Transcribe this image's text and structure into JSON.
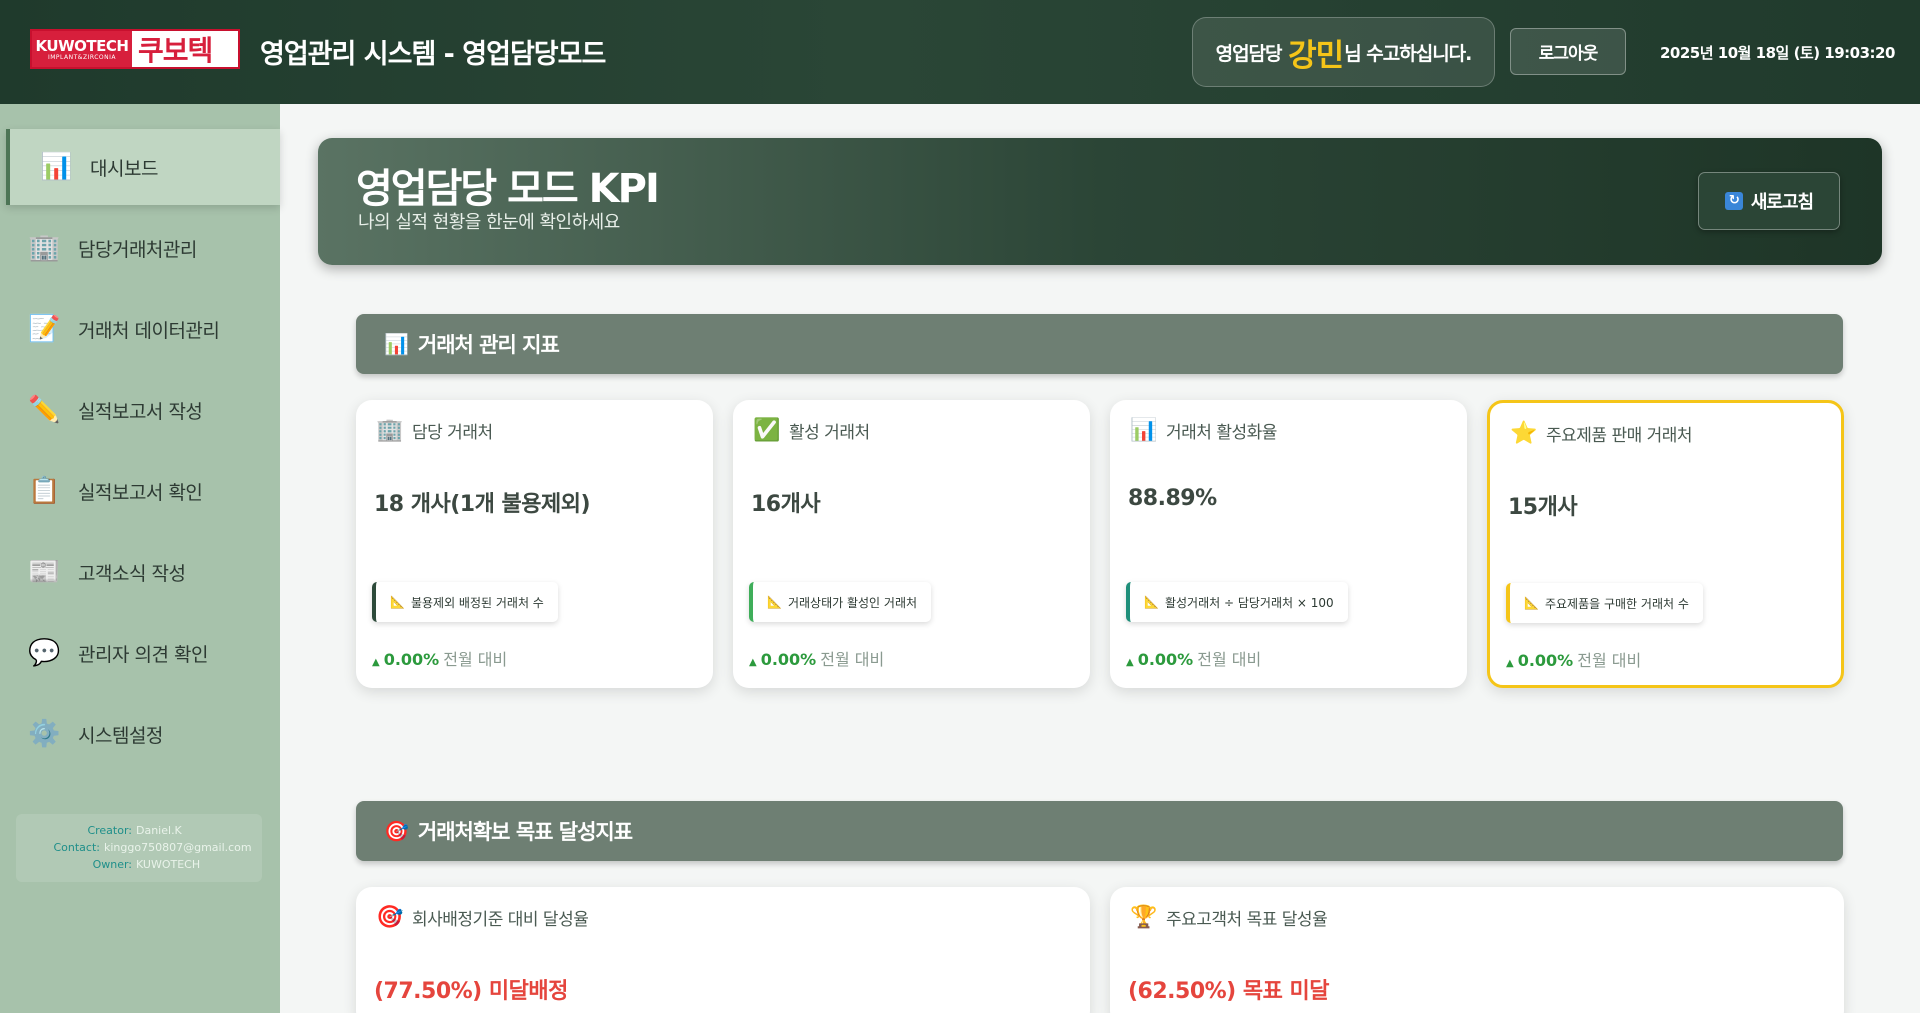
{
  "header": {
    "logo_en": "KUWOTECH",
    "logo_sub": "IMPLANT&ZIRCONIA",
    "logo_kr": "쿠보텍",
    "title": "영업관리 시스템 - 영업담당모드",
    "welcome_prefix": "영업담당",
    "user_name": "강민",
    "welcome_suffix": "님 수고하십니다.",
    "logout_label": "로그아웃",
    "datetime": "2025년 10월 18일 (토) 19:03:20"
  },
  "sidebar": {
    "items": [
      {
        "label": "대시보드",
        "icon": "chart-icon"
      },
      {
        "label": "담당거래처관리",
        "icon": "building-icon"
      },
      {
        "label": "거래처 데이터관리",
        "icon": "memo-icon"
      },
      {
        "label": "실적보고서 작성",
        "icon": "pencil-icon"
      },
      {
        "label": "실적보고서 확인",
        "icon": "clipboard-icon"
      },
      {
        "label": "고객소식 작성",
        "icon": "newspaper-icon"
      },
      {
        "label": "관리자 의견 확인",
        "icon": "speech-bubble-icon"
      },
      {
        "label": "시스템설정",
        "icon": "gear-icon"
      }
    ],
    "credits": {
      "creator_label": "Creator:",
      "creator": "Daniel.K",
      "contact_label": "Contact:",
      "contact": "kinggo750807@gmail.com",
      "owner_label": "Owner:",
      "owner": "KUWOTECH"
    }
  },
  "banner": {
    "title": "영업담당 모드 KPI",
    "subtitle": "나의 실적 현황을 한눈에 확인하세요",
    "refresh_label": "새로고침"
  },
  "section1": {
    "title": "거래처 관리 지표",
    "cards": [
      {
        "title": "담당 거래처",
        "value": "18 개사(1개 불용제외)",
        "note": "불용제외 배정된 거래처 수",
        "change": "0.00%",
        "change_label": "전월 대비",
        "accent": "#2d4a3a"
      },
      {
        "title": "활성 거래처",
        "value": "16개사",
        "note": "거래상태가 활성인 거래처",
        "change": "0.00%",
        "change_label": "전월 대비",
        "accent": "#3fae5a"
      },
      {
        "title": "거래처 활성화율",
        "value": "88.89%",
        "note": "활성거래처 ÷ 담당거래처 × 100",
        "change": "0.00%",
        "change_label": "전월 대비",
        "accent": "#1f8f7a"
      },
      {
        "title": "주요제품 판매 거래처",
        "value": "15개사",
        "note": "주요제품을 구매한 거래처 수",
        "change": "0.00%",
        "change_label": "전월 대비",
        "accent": "#f5c518"
      }
    ]
  },
  "section2": {
    "title": "거래처확보 목표 달성지표",
    "cards": [
      {
        "title": "회사배정기준 대비 달성율",
        "value": "(77.50%) 미달배정"
      },
      {
        "title": "주요고객처 목표 달성율",
        "value": "(62.50%) 목표 미달"
      }
    ]
  },
  "colors": {
    "header_bg": "#1f3a2c",
    "sidebar_bg": "#a7c2ab",
    "highlight": "#f5c518",
    "positive": "#2c9a3d",
    "negative": "#e5453d"
  }
}
